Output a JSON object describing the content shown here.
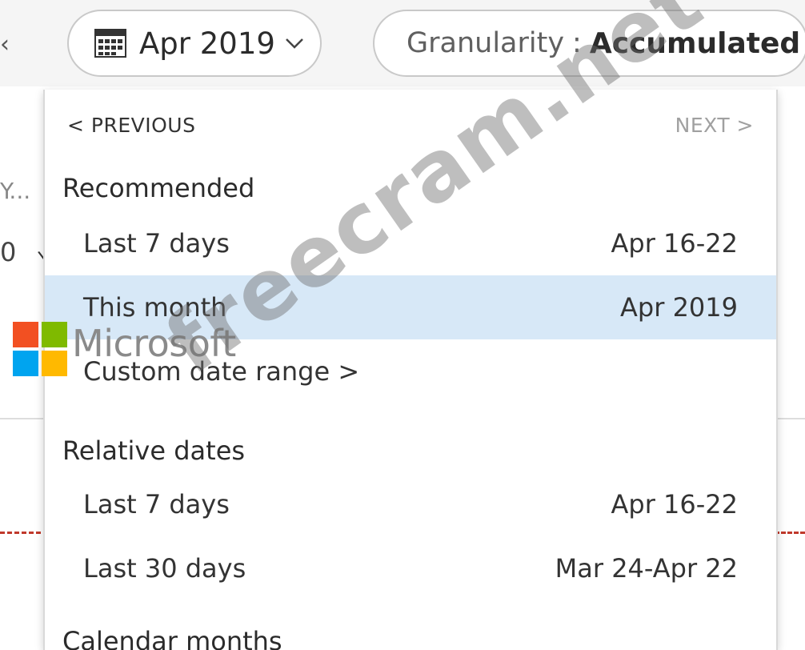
{
  "toolbar": {
    "date_button": {
      "label": "Apr 2019"
    },
    "granularity": {
      "label": "Granularity",
      "separator": ":",
      "value": "Accumulated"
    }
  },
  "background": {
    "truncated_text": "Y...",
    "digit": "0"
  },
  "dropdown": {
    "previous_label": "< PREVIOUS",
    "next_label": "NEXT >",
    "sections": [
      {
        "title": "Recommended",
        "options": [
          {
            "label": "Last 7 days",
            "range": "Apr 16-22"
          },
          {
            "label": "This month",
            "range": "Apr 2019",
            "selected": true
          },
          {
            "label": "Custom date range >"
          }
        ]
      },
      {
        "title": "Relative dates",
        "options": [
          {
            "label": "Last 7 days",
            "range": "Apr 16-22"
          },
          {
            "label": "Last 30 days",
            "range": "Mar 24-Apr 22"
          }
        ]
      },
      {
        "title": "Calendar months"
      }
    ]
  },
  "logo": {
    "text": "Microsoft"
  },
  "watermark": {
    "text": "freecram.net"
  },
  "colors": {
    "selected_bg": "#d7e8f7",
    "logo_red": "#f25022",
    "logo_green": "#7fba00",
    "logo_blue": "#00a4ef",
    "logo_yellow": "#ffb900"
  },
  "icons": [
    "calendar-icon",
    "chevron-down-icon",
    "chevron-left-icon",
    "chevron-right-icon"
  ]
}
